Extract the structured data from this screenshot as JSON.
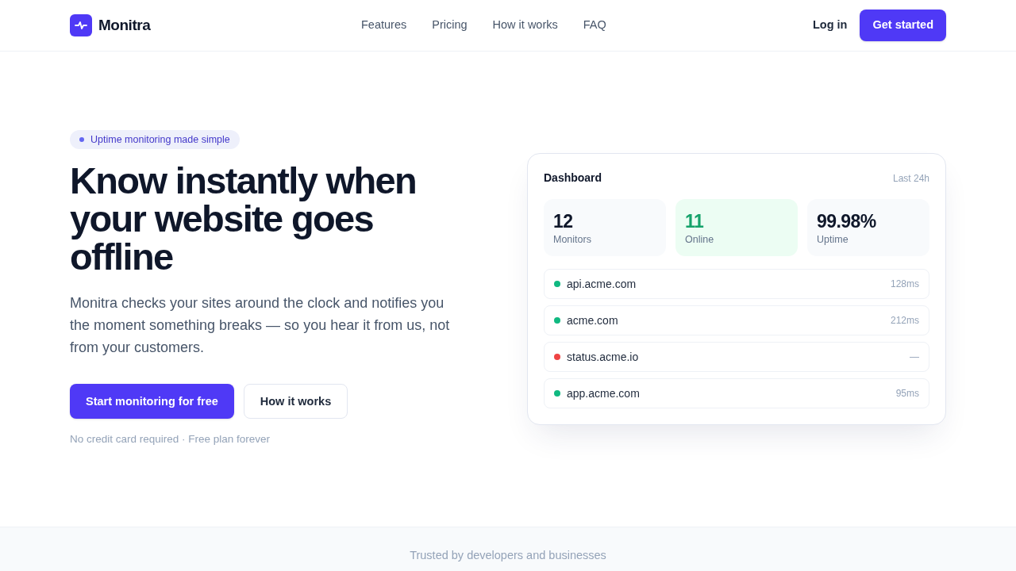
{
  "nav": {
    "brand": "Monitra",
    "links": [
      "Features",
      "Pricing",
      "How it works",
      "FAQ"
    ],
    "login": "Log in",
    "cta": "Get started"
  },
  "hero": {
    "badge": "Uptime monitoring made simple",
    "title": "Know instantly when your website goes offline",
    "description": "Monitra checks your sites around the clock and notifies you the moment something breaks — so you hear it from us, not from your customers.",
    "buttons": [
      {
        "label": "Start monitoring for free",
        "kind": "primary"
      },
      {
        "label": "How it works",
        "kind": "secondary"
      }
    ],
    "note": "No credit card required · Free plan forever"
  },
  "dashboard": {
    "title": "Dashboard",
    "period": "Last 24h",
    "stats": [
      {
        "value": "12",
        "label": "Monitors",
        "kind": "neutral"
      },
      {
        "value": "11",
        "label": "Online",
        "kind": "positive"
      },
      {
        "value": "99.98%",
        "label": "Uptime",
        "kind": "neutral"
      }
    ],
    "monitors": [
      {
        "host": "api.acme.com",
        "latency": "128ms",
        "color": "#10b981"
      },
      {
        "host": "acme.com",
        "latency": "212ms",
        "color": "#10b981"
      },
      {
        "host": "status.acme.io",
        "latency": "—",
        "color": "#ef4444"
      },
      {
        "host": "app.acme.com",
        "latency": "95ms",
        "color": "#10b981"
      }
    ]
  },
  "trusted": {
    "text": "Trusted by developers and businesses"
  }
}
